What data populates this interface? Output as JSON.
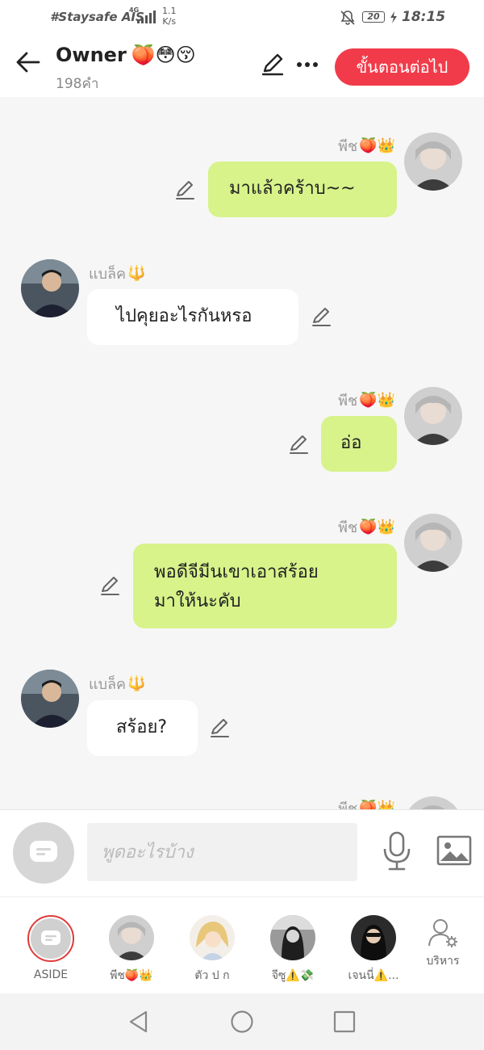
{
  "status_bar": {
    "carrier": "#Staysafe AIS",
    "network": "4G",
    "speed_value": "1.1",
    "speed_unit": "K/s",
    "battery": "20",
    "time": "18:15"
  },
  "header": {
    "title": "Owner",
    "title_emojis": "🍑😳😚",
    "word_count": "198คำ",
    "next_button": "ขั้นตอนต่อไป"
  },
  "messages": [
    {
      "side": "mine",
      "sender": "พีช",
      "sender_emoji": "🍑👑",
      "text": "มาแล้วคร้าบ~~"
    },
    {
      "side": "theirs",
      "sender": "แบล็ค",
      "sender_emoji": "🔱",
      "text": "ไปคุยอะไรกันหรอ"
    },
    {
      "side": "mine",
      "sender": "พีช",
      "sender_emoji": "🍑👑",
      "text": "อ่อ"
    },
    {
      "side": "mine",
      "sender": "พีช",
      "sender_emoji": "🍑👑",
      "text_line1": "พอดีจีมีนเขาเอาสร้อย",
      "text_line2": "มาให้นะคับ"
    },
    {
      "side": "theirs",
      "sender": "แบล็ค",
      "sender_emoji": "🔱",
      "text": "สร้อย?"
    },
    {
      "side": "mine",
      "sender": "พีช",
      "sender_emoji": "🍑👑"
    }
  ],
  "composer": {
    "placeholder": "พูดอะไรบ้าง"
  },
  "roles": [
    {
      "label": "ASIDE"
    },
    {
      "label": "พีช🍑👑"
    },
    {
      "label": "ตัว ป ก"
    },
    {
      "label": "จีซู⚠️💸"
    },
    {
      "label": "เจนนี่⚠️..."
    },
    {
      "label": "บริหาร"
    }
  ],
  "colors": {
    "accent": "#f23b4a",
    "my_bubble": "#d7f38a",
    "their_bubble": "#ffffff",
    "background": "#f6f6f6"
  },
  "icons": {
    "back": "arrow-left-icon",
    "edit": "pencil-icon",
    "more": "more-dots-icon",
    "aside": "chat-bubble-icon",
    "mic": "microphone-icon",
    "image": "image-icon",
    "manage": "user-gear-icon"
  }
}
